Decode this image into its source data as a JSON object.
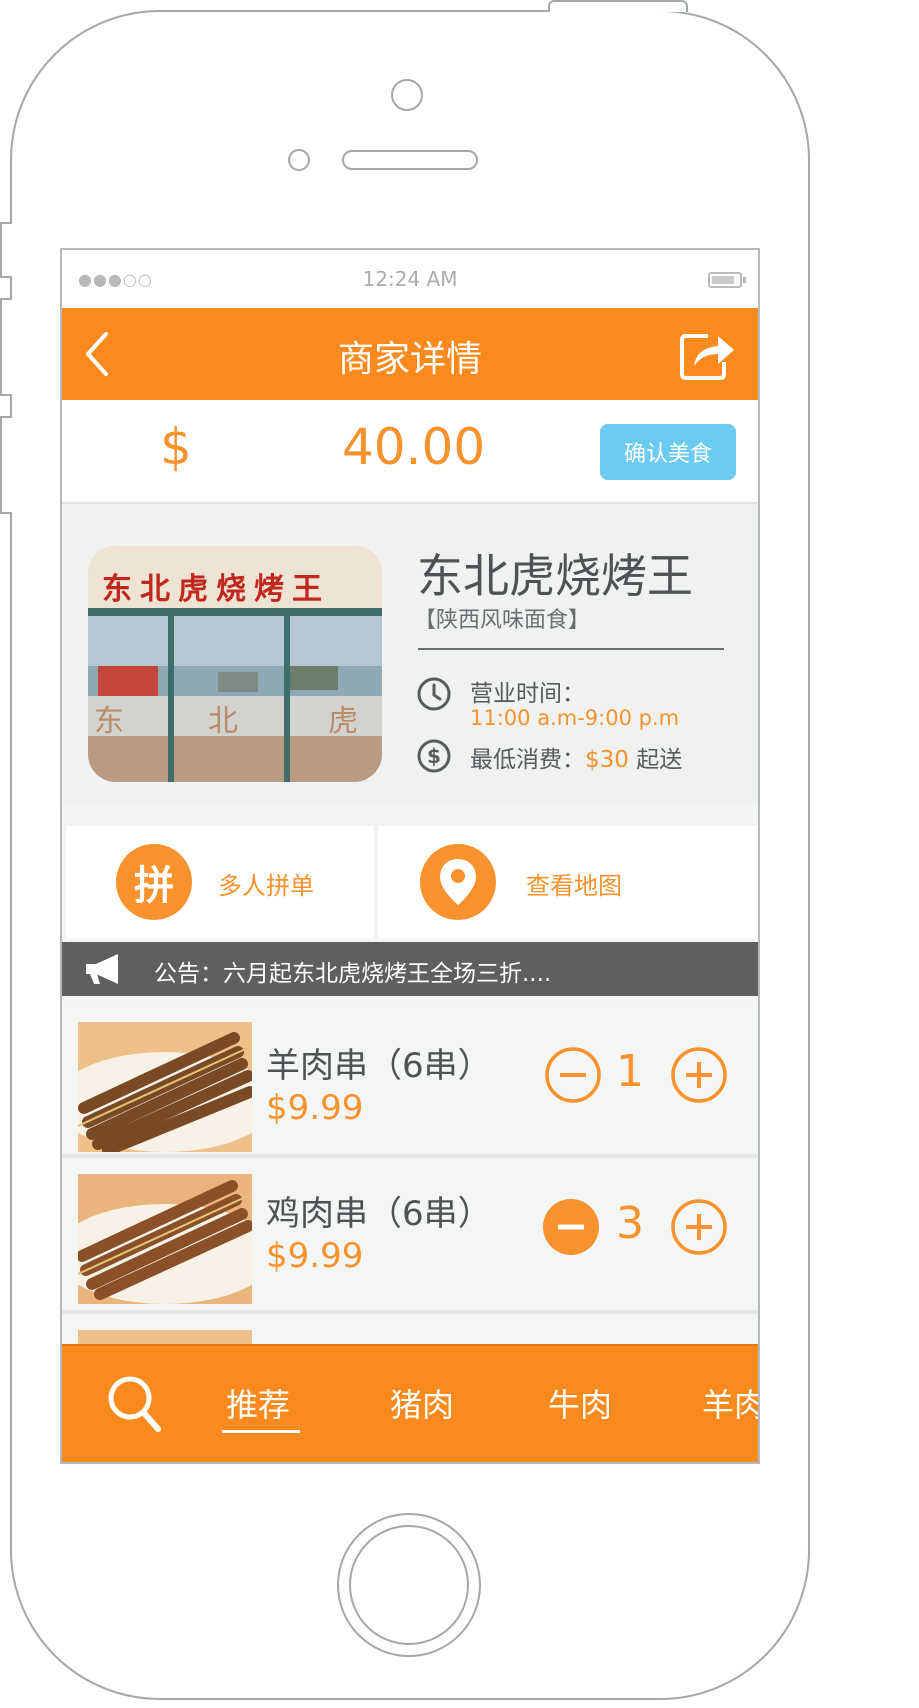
{
  "status_bar": {
    "signal": "●●●○○",
    "time": "12:24 AM"
  },
  "nav": {
    "title": "商家详情",
    "back_icon": "chevron-left-icon",
    "share_icon": "share-icon"
  },
  "order": {
    "currency": "$",
    "amount": "40.00",
    "confirm_label": "确认美食"
  },
  "shop": {
    "name": "东北虎烧烤王",
    "category": "【陕西风味面食】",
    "hours_label": "营业时间：",
    "hours_value": "11:00 a.m-9:00 p.m",
    "min_label": "最低消费：",
    "min_value": "$30",
    "min_suffix": "起送",
    "photo_sign": "东北虎烧烤王",
    "photo_window_text": [
      "东",
      "北",
      "虎"
    ]
  },
  "actions": [
    {
      "icon_text": "拼",
      "label": "多人拼单"
    },
    {
      "icon": "map-pin-icon",
      "label": "查看地图"
    }
  ],
  "notice": {
    "icon": "megaphone-icon",
    "text": "公告：六月起东北虎烧烤王全场三折...."
  },
  "items": [
    {
      "name": "羊肉串（6串）",
      "price": "$9.99",
      "qty": "1"
    },
    {
      "name": "鸡肉串（6串）",
      "price": "$9.99",
      "qty": "3"
    }
  ],
  "tabbar": {
    "search_icon": "search-icon",
    "tabs": [
      "推荐",
      "猪肉",
      "牛肉",
      "羊肉"
    ],
    "active_tab": "推荐"
  },
  "colors": {
    "accent": "#fa8a1d",
    "confirm": "#6ccbf2",
    "notice_bg": "#5f5f5f"
  }
}
